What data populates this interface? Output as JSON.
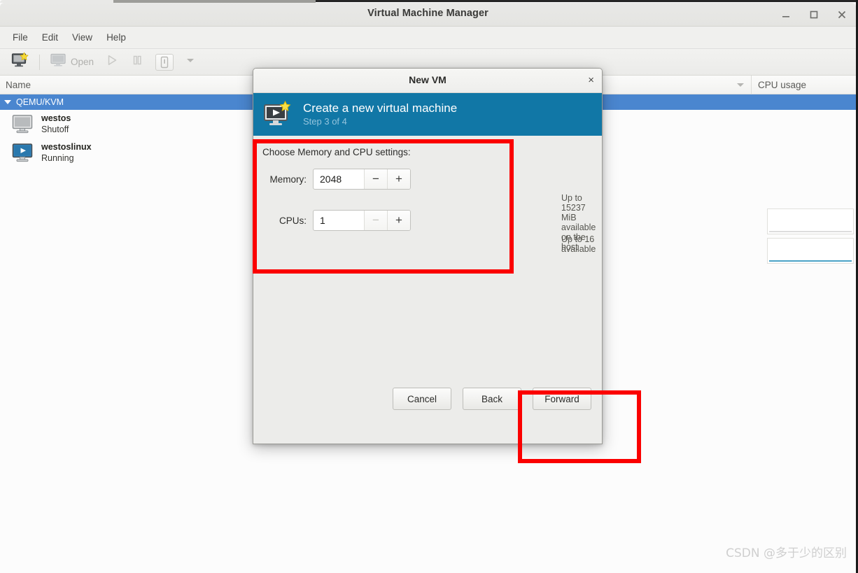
{
  "window": {
    "title": "Virtual Machine Manager",
    "controls": {
      "minimize": "minimize-icon",
      "maximize": "maximize-icon",
      "close": "close-icon"
    }
  },
  "menubar": {
    "items": [
      {
        "label": "File"
      },
      {
        "label": "Edit"
      },
      {
        "label": "View"
      },
      {
        "label": "Help"
      }
    ]
  },
  "toolbar": {
    "new_vm_icon": "new-vm-icon",
    "open_icon": "monitor-icon",
    "open_label": "Open",
    "run_icon": "play-icon",
    "pause_icon": "pause-icon",
    "shutdown_icon": "shutdown-icon",
    "dropdown_icon": "chevron-down-icon"
  },
  "columns": {
    "name": "Name",
    "cpu_usage": "CPU usage",
    "sort_icon": "sort-descending-icon"
  },
  "vm_list": {
    "group": {
      "label": "QEMU/KVM",
      "expanded": true
    },
    "rows": [
      {
        "name": "westos",
        "state": "Shutoff",
        "icon": "monitor-off-icon",
        "cpu_trend_color": "#d9d9d9"
      },
      {
        "name": "westoslinux",
        "state": "Running",
        "icon": "monitor-running-icon",
        "cpu_trend_color": "#4aa3c7"
      }
    ]
  },
  "dialog": {
    "title": "New VM",
    "close_label": "×",
    "banner": {
      "icon": "new-vm-wizard-icon",
      "title": "Create a new virtual machine",
      "step": "Step 3 of 4"
    },
    "form": {
      "heading": "Choose Memory and CPU settings:",
      "memory": {
        "label": "Memory:",
        "value": "2048",
        "decrement": "−",
        "increment": "+",
        "hint": "Up to 15237 MiB available on the host",
        "decrement_disabled": false
      },
      "cpus": {
        "label": "CPUs:",
        "value": "1",
        "decrement": "−",
        "increment": "+",
        "hint": "Up to 16 available",
        "decrement_disabled": true
      }
    },
    "buttons": {
      "cancel": "Cancel",
      "back": "Back",
      "forward": "Forward"
    }
  },
  "annotations": {
    "accent_color": "#fb0000",
    "boxes": [
      {
        "name": "memory-cpu-settings-highlight"
      },
      {
        "name": "forward-button-highlight"
      }
    ]
  },
  "watermark": {
    "text": "CSDN @多于少的区别"
  }
}
